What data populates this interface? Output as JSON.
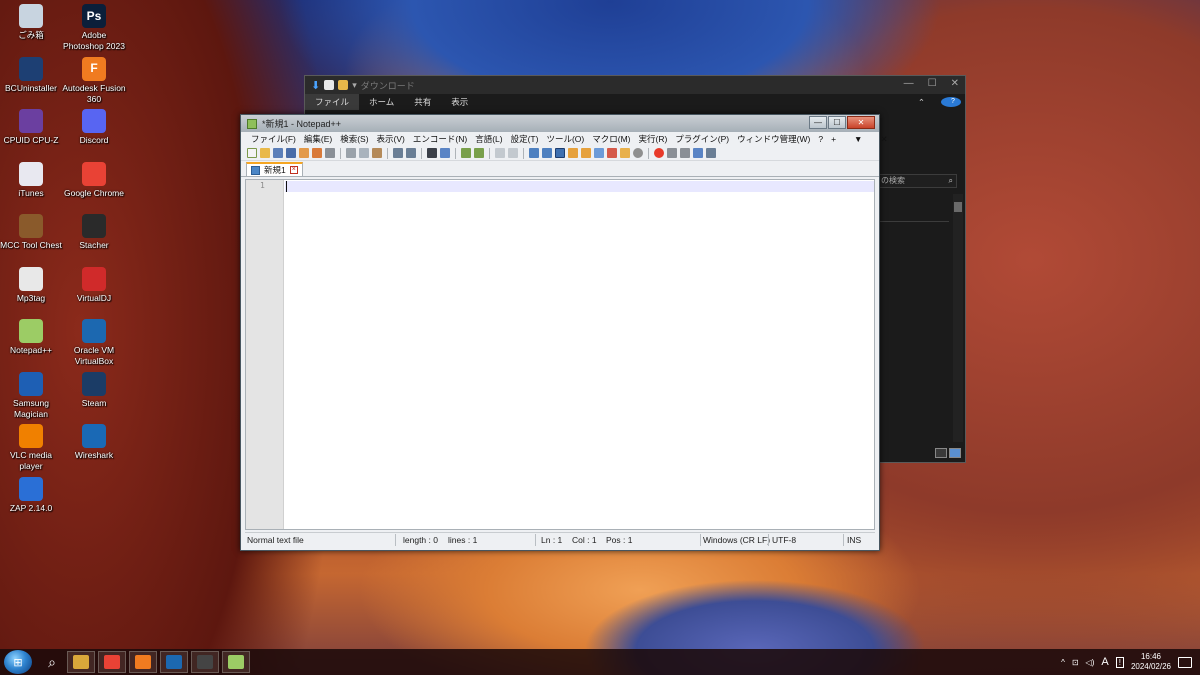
{
  "desktop": {
    "icons": [
      {
        "label": "ごみ箱",
        "icon": "recycle-bin-icon",
        "color": "#c8d4e0"
      },
      {
        "label": "Adobe Photoshop 2023",
        "icon": "photoshop-icon",
        "color": "#0b1f3a",
        "glyph": "Ps"
      },
      {
        "label": "BCUninstaller",
        "icon": "bcuninstaller-icon",
        "color": "#1d3f73"
      },
      {
        "label": "Autodesk Fusion 360",
        "icon": "fusion360-icon",
        "color": "#f07b20",
        "glyph": "F"
      },
      {
        "label": "CPUID CPU-Z",
        "icon": "cpuz-icon",
        "color": "#6b3fa0"
      },
      {
        "label": "Discord",
        "icon": "discord-icon",
        "color": "#5865f2"
      },
      {
        "label": "iTunes",
        "icon": "itunes-icon",
        "color": "#e8e8f0"
      },
      {
        "label": "Google Chrome",
        "icon": "chrome-icon",
        "color": "#e94235"
      },
      {
        "label": "MCC Tool Chest",
        "icon": "mcc-tool-chest-icon",
        "color": "#8a5a2b"
      },
      {
        "label": "Stacher",
        "icon": "stacher-icon",
        "color": "#2a2a2a"
      },
      {
        "label": "Mp3tag",
        "icon": "mp3tag-icon",
        "color": "#e8e8e8"
      },
      {
        "label": "VirtualDJ",
        "icon": "virtualdj-icon",
        "color": "#d02a2a"
      },
      {
        "label": "Notepad++",
        "icon": "notepadpp-icon",
        "color": "#9ccc65"
      },
      {
        "label": "Oracle VM VirtualBox",
        "icon": "virtualbox-icon",
        "color": "#1c68b0"
      },
      {
        "label": "Samsung Magician",
        "icon": "samsung-magician-icon",
        "color": "#1e5fb4"
      },
      {
        "label": "Steam",
        "icon": "steam-icon",
        "color": "#1b3c66"
      },
      {
        "label": "VLC media player",
        "icon": "vlc-icon",
        "color": "#f08000"
      },
      {
        "label": "Wireshark",
        "icon": "wireshark-icon",
        "color": "#1a69b5"
      },
      {
        "label": "ZAP 2.14.0",
        "icon": "zap-icon",
        "color": "#2a6fd6"
      }
    ]
  },
  "explorer": {
    "title": "ダウンロード",
    "ribbon_tabs": [
      "ファイル",
      "ホーム",
      "共有",
      "表示"
    ],
    "search_placeholder": "の検索",
    "help": "?",
    "caption": {
      "minimize": "—",
      "maximize": "☐",
      "close": "✕"
    }
  },
  "notepad": {
    "title": "*新規1 - Notepad++",
    "menu": [
      "ファイル(F)",
      "編集(E)",
      "検索(S)",
      "表示(V)",
      "エンコード(N)",
      "言語(L)",
      "設定(T)",
      "ツール(O)",
      "マクロ(M)",
      "実行(R)",
      "プラグイン(P)",
      "ウィンドウ管理(W)",
      "?"
    ],
    "menu_right": [
      "+",
      "▼",
      "✕"
    ],
    "tab_label": "新規1",
    "line_number": "1",
    "status": {
      "file_type": "Normal text file",
      "length": "length : 0",
      "lines": "lines : 1",
      "ln": "Ln : 1",
      "col": "Col : 1",
      "pos": "Pos : 1",
      "eol": "Windows (CR LF)",
      "encoding": "UTF-8",
      "mode": "INS"
    },
    "caption": {
      "minimize": "—",
      "maximize": "☐",
      "close": "✕"
    }
  },
  "taskbar": {
    "apps": [
      {
        "name": "file-explorer",
        "color": "#d9a73a"
      },
      {
        "name": "chrome",
        "color": "#e94235"
      },
      {
        "name": "search-app",
        "color": "#f07b20"
      },
      {
        "name": "virtualbox",
        "color": "#1c68b0"
      },
      {
        "name": "calculator",
        "color": "#444444"
      },
      {
        "name": "notepadpp",
        "color": "#9ccc65"
      }
    ],
    "tray": {
      "chevron": "^",
      "ime": "A",
      "time": "16:46",
      "date": "2024/02/26"
    }
  }
}
